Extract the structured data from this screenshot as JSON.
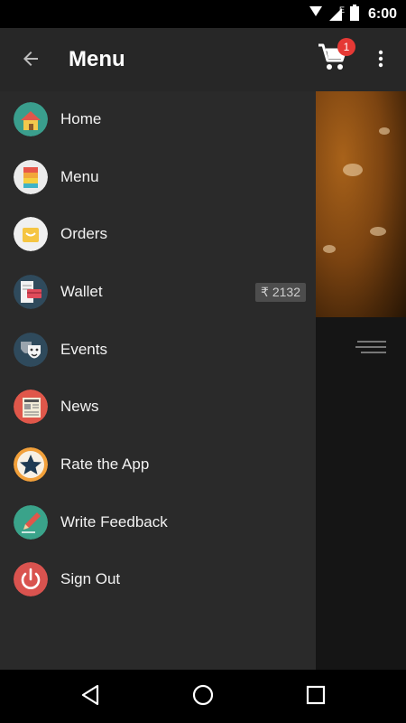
{
  "status_bar": {
    "time": "6:00",
    "network_label": "E"
  },
  "app_bar": {
    "title": "Menu",
    "cart_count": "1"
  },
  "drawer": {
    "items": [
      {
        "label": "Home",
        "icon": "home-icon"
      },
      {
        "label": "Menu",
        "icon": "menu-book-icon"
      },
      {
        "label": "Orders",
        "icon": "shopping-bag-icon"
      },
      {
        "label": "Wallet",
        "icon": "wallet-icon",
        "badge": "₹ 2132"
      },
      {
        "label": "Events",
        "icon": "theater-masks-icon"
      },
      {
        "label": "News",
        "icon": "newspaper-icon"
      },
      {
        "label": "Rate the App",
        "icon": "star-icon"
      },
      {
        "label": "Write Feedback",
        "icon": "pencil-icon"
      },
      {
        "label": "Sign Out",
        "icon": "power-icon"
      }
    ]
  },
  "colors": {
    "app_bar": "#272727",
    "drawer": "#2a2a2a",
    "badge": "#e53935"
  }
}
